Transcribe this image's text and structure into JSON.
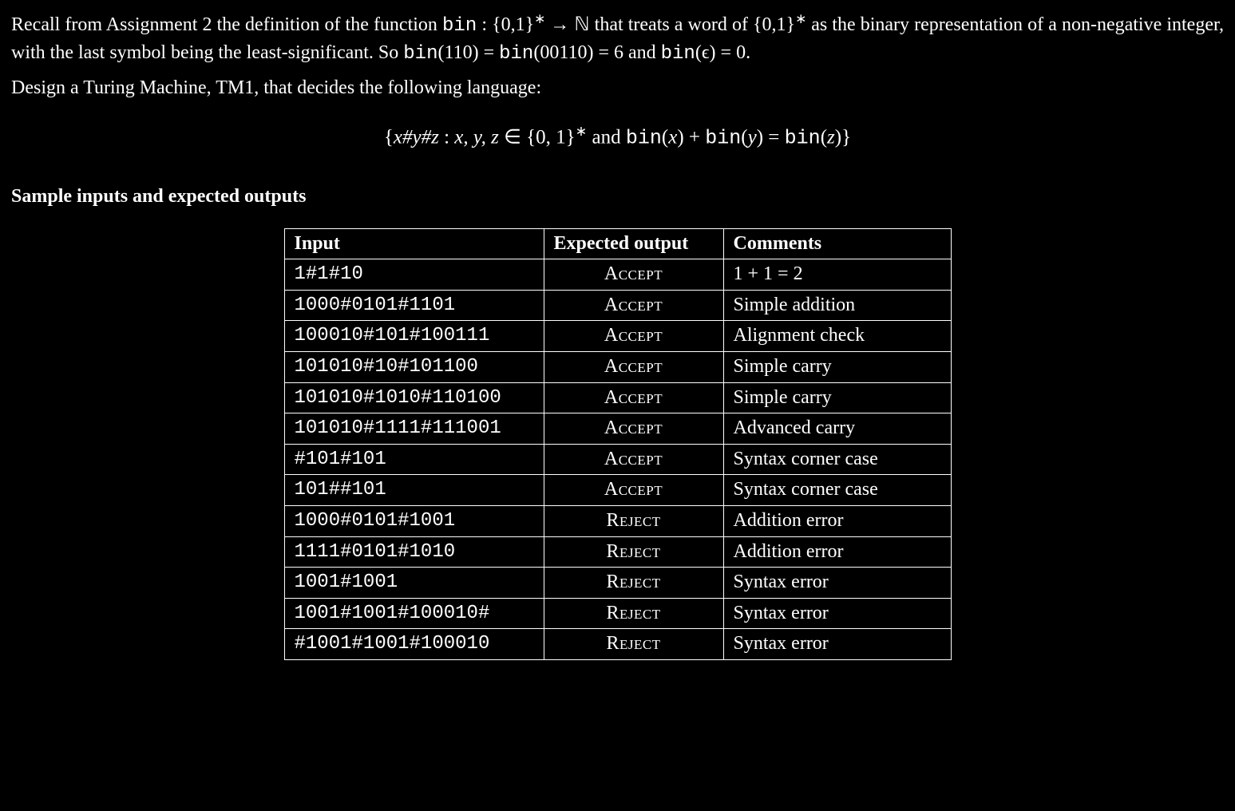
{
  "intro": {
    "p1_a": "Recall from Assignment 2 the definition of the function ",
    "p1_b": "bin",
    "p1_c": " : {0,1}",
    "p1_star1": "∗",
    "p1_d": " → ℕ that treats a word of {0,1}",
    "p1_star2": "∗",
    "p1_e": " as the binary representation of a non-negative integer, with the last symbol being the least-significant. So ",
    "p1_f": "bin",
    "p1_g": "(110) = ",
    "p1_h": "bin",
    "p1_i": "(00110) = 6 and ",
    "p1_j": "bin",
    "p1_k": "(ϵ) = 0.",
    "p2": "Design a Turing Machine, TM1, that decides the following language:",
    "formula_a": "{",
    "formula_b": "x#y#z",
    "formula_c": " : ",
    "formula_d": "x, y, z",
    "formula_e": " ∈ {0, 1}",
    "formula_star": "∗",
    "formula_f": " and ",
    "formula_g": "bin",
    "formula_h": "(",
    "formula_i": "x",
    "formula_j": ") + ",
    "formula_k": "bin",
    "formula_l": "(",
    "formula_m": "y",
    "formula_n": ") = ",
    "formula_o": "bin",
    "formula_p": "(",
    "formula_q": "z",
    "formula_r": ")}"
  },
  "section_title": "Sample inputs and expected outputs",
  "headers": {
    "input": "Input",
    "output": "Expected output",
    "comment": "Comments"
  },
  "rows": [
    {
      "input": "1#1#10",
      "output": "Accept",
      "comment": "1 + 1 = 2"
    },
    {
      "input": "1000#0101#1101",
      "output": "Accept",
      "comment": "Simple addition"
    },
    {
      "input": "100010#101#100111",
      "output": "Accept",
      "comment": "Alignment check"
    },
    {
      "input": "101010#10#101100",
      "output": "Accept",
      "comment": "Simple carry"
    },
    {
      "input": "101010#1010#110100",
      "output": "Accept",
      "comment": "Simple carry"
    },
    {
      "input": "101010#1111#111001",
      "output": "Accept",
      "comment": "Advanced carry"
    },
    {
      "input": "#101#101",
      "output": "Accept",
      "comment": "Syntax corner case"
    },
    {
      "input": "101##101",
      "output": "Accept",
      "comment": "Syntax corner case"
    },
    {
      "input": "1000#0101#1001",
      "output": "Reject",
      "comment": "Addition error"
    },
    {
      "input": "1111#0101#1010",
      "output": "Reject",
      "comment": "Addition error"
    },
    {
      "input": "1001#1001",
      "output": "Reject",
      "comment": "Syntax error"
    },
    {
      "input": "1001#1001#100010#",
      "output": "Reject",
      "comment": "Syntax error"
    },
    {
      "input": "#1001#1001#100010",
      "output": "Reject",
      "comment": "Syntax error"
    }
  ]
}
